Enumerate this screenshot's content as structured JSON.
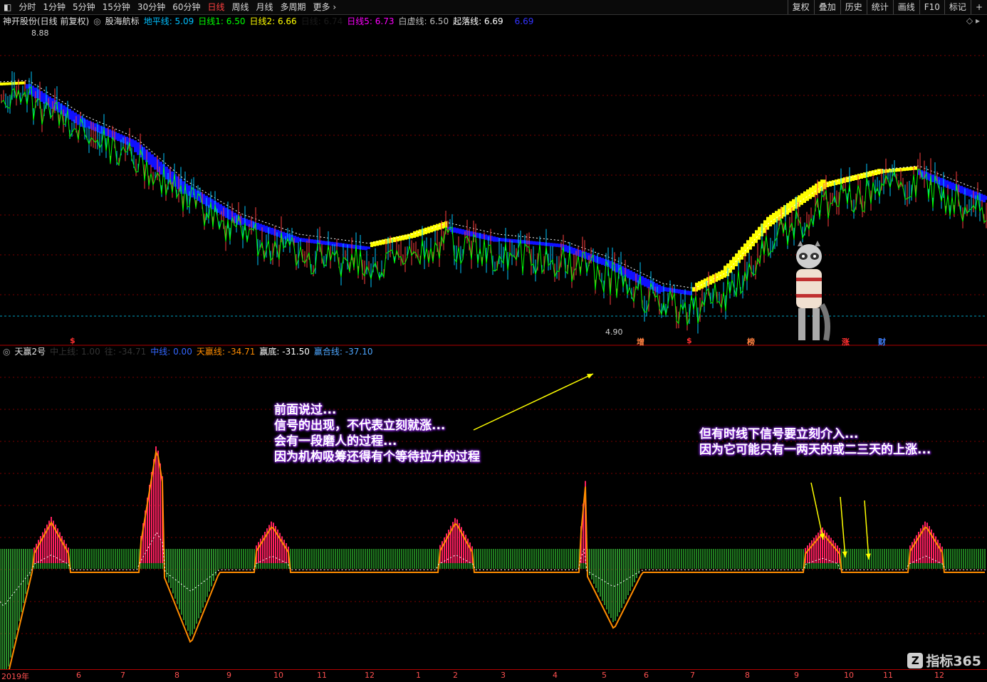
{
  "toolbar": {
    "periods": [
      "分时",
      "1分钟",
      "5分钟",
      "15分钟",
      "30分钟",
      "60分钟",
      "日线",
      "周线",
      "月线",
      "多周期",
      "更多"
    ],
    "active_period": "日线",
    "right_buttons": [
      "复权",
      "叠加",
      "历史",
      "统计",
      "画线",
      "F10",
      "标记",
      "+"
    ]
  },
  "main_legend": {
    "stock": "神开股份(日线 前复权)",
    "indicator": "股海航标",
    "items": [
      {
        "label": "地平线: 5.09",
        "color": "#00bfff"
      },
      {
        "label": "日线1: 6.50",
        "color": "#00ff00"
      },
      {
        "label": "日线2: 6.66",
        "color": "#ffff00"
      },
      {
        "label": "日线: 6.74",
        "color": "#1a1a1a"
      },
      {
        "label": "日线5: 6.73",
        "color": "#ff00ff"
      },
      {
        "label": "白虚线: 6.50",
        "color": "#bbbbbb"
      },
      {
        "label": "起落线: 6.69",
        "color": "#ffffff"
      },
      {
        "label": "6.69",
        "color": "#3333ff"
      }
    ]
  },
  "price_labels": {
    "high": "8.88",
    "low": "4.90"
  },
  "markers": [
    {
      "text": "$",
      "color": "#ff3030"
    },
    {
      "text": "增",
      "color": "#ff8040"
    },
    {
      "text": "$",
      "color": "#ff3030"
    },
    {
      "text": "榜",
      "color": "#ff8040"
    },
    {
      "text": "涨",
      "color": "#ff3030"
    },
    {
      "text": "财",
      "color": "#4080ff"
    }
  ],
  "sub_legend": {
    "name": "天赢2号",
    "items": [
      {
        "label": "中上线: 1.00",
        "color": "#333333"
      },
      {
        "label": "往: -34.71",
        "color": "#333333"
      },
      {
        "label": "中线: 0.00",
        "color": "#3366ff"
      },
      {
        "label": "天赢线: -34.71",
        "color": "#ff8c00"
      },
      {
        "label": "赢底: -31.50",
        "color": "#ffffff"
      },
      {
        "label": "赢合线: -37.10",
        "color": "#4da6ff"
      }
    ]
  },
  "notes": {
    "left": [
      "前面说过...",
      "信号的出现，不代表立刻就涨...",
      "会有一段磨人的过程...",
      "因为机构吸筹还得有个等待拉升的过程"
    ],
    "right": [
      "但有时线下信号要立刻介入...",
      "因为它可能只有一两天的或二三天的上涨..."
    ]
  },
  "time_axis": [
    "2019年",
    "6",
    "7",
    "8",
    "9",
    "10",
    "11",
    "12",
    "1",
    "2",
    "3",
    "4",
    "5",
    "6",
    "7",
    "8",
    "9",
    "10",
    "11",
    "12"
  ],
  "watermark": "指标365",
  "colors": {
    "up": "#ff4040",
    "down": "#00c8ff",
    "ma_up": "#ffff00",
    "ma_down": "#1010ff"
  }
}
